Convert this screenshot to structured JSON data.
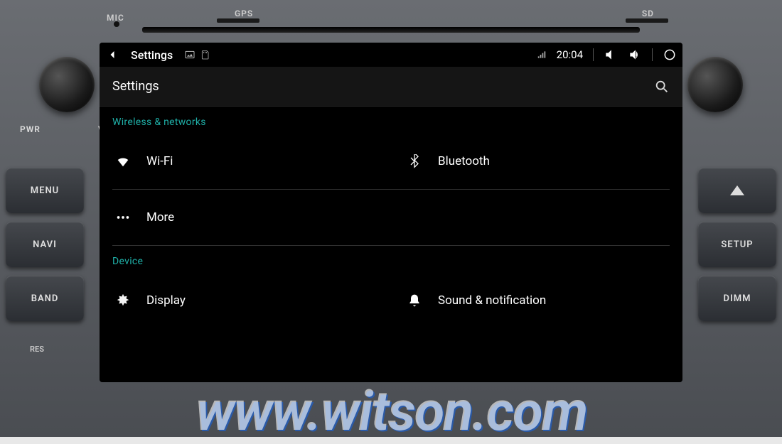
{
  "hardware": {
    "top_labels": {
      "mic": "MIC",
      "gps": "GPS",
      "sd": "SD"
    },
    "knob_labels": {
      "pwr": "PWR",
      "vol": "VOL"
    },
    "left_buttons": {
      "menu": "MENU",
      "navi": "NAVI",
      "band": "BAND"
    },
    "right_buttons": {
      "eject": "▲",
      "setup": "SETUP",
      "dimm": "DIMM"
    },
    "res": "RES"
  },
  "statusbar": {
    "back_icon": "back-icon",
    "title": "Settings",
    "tray_icons": [
      "image-icon",
      "sdcard-icon"
    ],
    "right_icons": [
      "signal-icon"
    ],
    "time": "20:04",
    "controls": [
      "volume-down-icon",
      "volume-up-icon",
      "home-icon"
    ]
  },
  "header": {
    "title": "Settings",
    "search_icon": "search-icon"
  },
  "sections": {
    "wireless": {
      "label": "Wireless & networks",
      "items": [
        {
          "icon": "wifi-icon",
          "label": "Wi-Fi"
        },
        {
          "icon": "bluetooth-icon",
          "label": "Bluetooth"
        },
        {
          "icon": "more-icon",
          "label": "More"
        }
      ]
    },
    "device": {
      "label": "Device",
      "items": [
        {
          "icon": "display-icon",
          "label": "Display"
        },
        {
          "icon": "sound-icon",
          "label": "Sound & notification"
        }
      ]
    }
  },
  "watermark": "www.witson.com"
}
